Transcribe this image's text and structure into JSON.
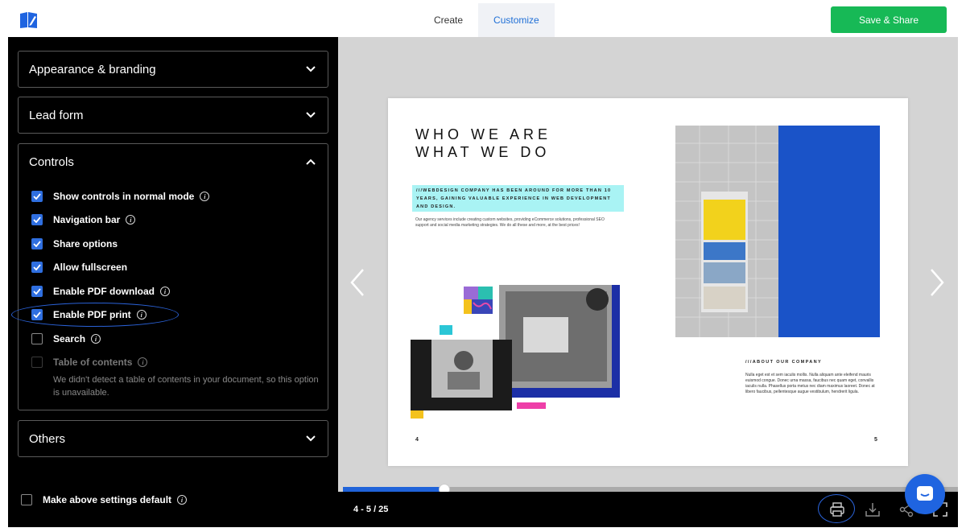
{
  "header": {
    "logo_icon": "book-pencil-icon",
    "tabs": [
      {
        "label": "Create",
        "active": false
      },
      {
        "label": "Customize",
        "active": true
      }
    ],
    "save_label": "Save & Share",
    "accent_color": "#17b956"
  },
  "sidebar": {
    "sections": {
      "appearance": {
        "title": "Appearance & branding",
        "expanded": false
      },
      "lead_form": {
        "title": "Lead form",
        "expanded": false
      },
      "controls": {
        "title": "Controls",
        "expanded": true
      },
      "others": {
        "title": "Others",
        "expanded": false
      }
    },
    "controls": {
      "options": [
        {
          "label": "Show controls in normal mode",
          "checked": true
        },
        {
          "label": "Navigation bar",
          "checked": true
        },
        {
          "label": "Share options",
          "checked": true
        },
        {
          "label": "Allow fullscreen",
          "checked": true
        },
        {
          "label": "Enable PDF download",
          "checked": true
        },
        {
          "label": "Enable PDF print",
          "checked": true
        },
        {
          "label": "Search",
          "checked": false
        },
        {
          "label": "Table of contents",
          "checked": false,
          "disabled": true
        }
      ],
      "toc_note": "We didn't detect a table of contents in your document, so this option is unavailable."
    },
    "default_label": "Make above settings default"
  },
  "viewer": {
    "document": {
      "headline_line1": "WHO WE ARE",
      "headline_line2": "WHAT WE DO",
      "intro_highlight": "///WEBDESIGN COMPANY HAS BEEN AROUND FOR MORE THAN 10 YEARS, GAINING VALUABLE EXPERIENCE IN WEB DEVELOPMENT AND DESIGN.",
      "intro_body": "Our agency services include creating custom websites, providing eCommerce solutions, professional SEO support and social media marketing strategies. We do all these and more, at the best prices!",
      "about_title": "///ABOUT OUR COMPANY",
      "about_body": "Nulla eget est et sem iaculis mollis. Nulla aliquam ante eleifend mauris euismod congue. Donec urna massa, faucibus nec quam eget, convallis iaculis nulla. Phasellus porta metus nec diam maximus laoreet. Donec at libero faucibus, pellentesque augue vestibulum, hendrerit ligula.",
      "page_left": "4",
      "page_right": "5"
    },
    "page_indicator": "4 - 5 / 25",
    "progress": 0.165,
    "tools": [
      "printer-icon",
      "download-icon",
      "share-icon",
      "fullscreen-icon"
    ]
  },
  "chat": {
    "icon": "chat-icon",
    "color": "#1f64e0"
  }
}
